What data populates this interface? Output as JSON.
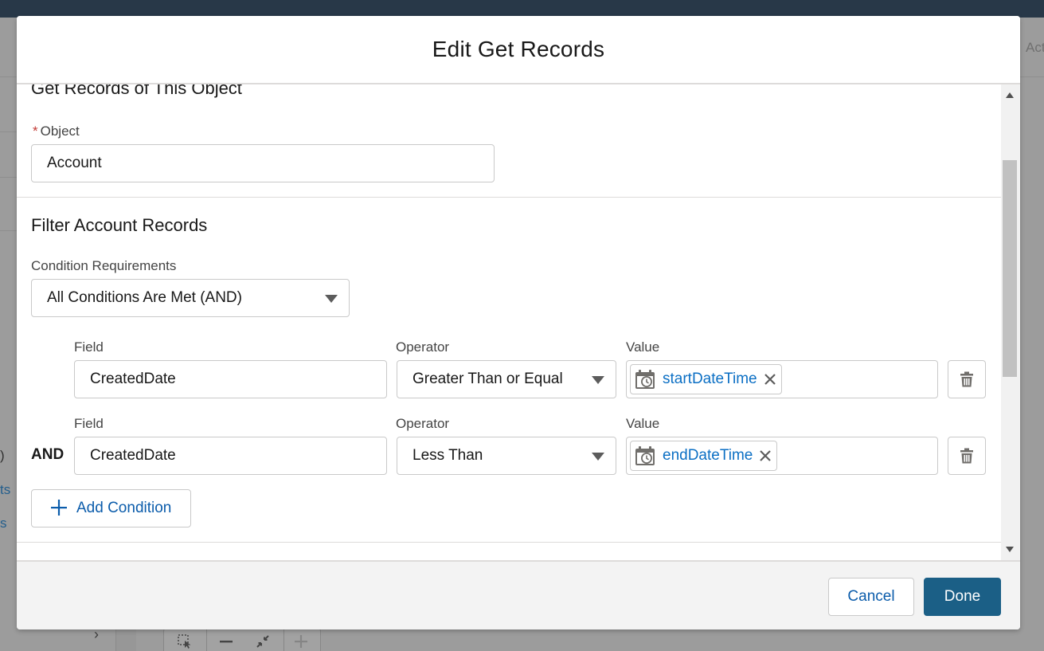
{
  "modal": {
    "title": "Edit Get Records"
  },
  "object_section": {
    "heading": "Get Records of This Object",
    "object_label": "Object",
    "required_mark": "*",
    "object_value": "Account"
  },
  "filter_section": {
    "heading": "Filter Account Records",
    "condition_requirements_label": "Condition Requirements",
    "condition_requirements_value": "All Conditions Are Met (AND)",
    "conditions": [
      {
        "connector": "",
        "field_label": "Field",
        "field_value": "CreatedDate",
        "operator_label": "Operator",
        "operator_value": "Greater Than or Equal",
        "value_label": "Value",
        "value_resource": "startDateTime",
        "value_icon": "calendar-clock-icon"
      },
      {
        "connector": "AND",
        "field_label": "Field",
        "field_value": "CreatedDate",
        "operator_label": "Operator",
        "operator_value": "Less Than",
        "value_label": "Value",
        "value_resource": "endDateTime",
        "value_icon": "calendar-clock-icon"
      }
    ],
    "add_condition_label": "Add Condition"
  },
  "footer": {
    "cancel_label": "Cancel",
    "done_label": "Done"
  },
  "background": {
    "partial_text_right": "Activ",
    "partial_text_left_1": ")",
    "partial_text_left_2": "ts",
    "partial_text_left_3": "s"
  },
  "colors": {
    "brand_dark": "#1b5f86",
    "link_blue": "#0b5cab",
    "resource_blue": "#0b6fc4",
    "top_bar": "#0b2b4a",
    "required_red": "#c23934"
  }
}
